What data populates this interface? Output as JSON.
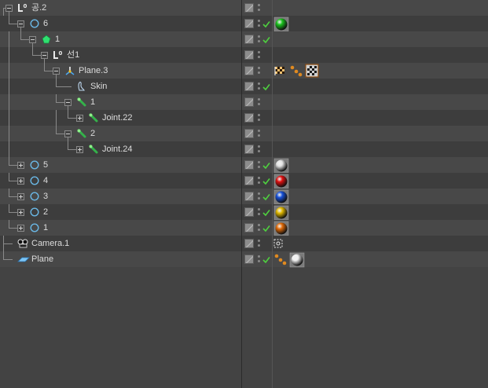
{
  "objects": [
    {
      "name": "공.2",
      "type": "null",
      "depth": 0,
      "expander": "minus",
      "check": false,
      "tags": []
    },
    {
      "name": "6",
      "type": "sphere",
      "depth": 1,
      "expander": "minus",
      "check": true,
      "tags": [
        {
          "kind": "material",
          "color": "#19c21c"
        }
      ]
    },
    {
      "name": "1",
      "type": "pentagon",
      "depth": 2,
      "expander": "minus",
      "check": true,
      "tags": []
    },
    {
      "name": "선1",
      "type": "null",
      "depth": 3,
      "expander": "minus",
      "check": false,
      "tags": []
    },
    {
      "name": "Plane.3",
      "type": "plane-deform",
      "depth": 4,
      "expander": "minus",
      "check": false,
      "tags": [
        {
          "kind": "checker-flag"
        },
        {
          "kind": "ik-dots"
        },
        {
          "kind": "checker"
        }
      ]
    },
    {
      "name": "Skin",
      "type": "skin",
      "depth": 5,
      "expander": "none",
      "check": true,
      "tags": []
    },
    {
      "name": "1",
      "type": "joint",
      "depth": 5,
      "expander": "minus",
      "check": false,
      "tags": []
    },
    {
      "name": "Joint.22",
      "type": "joint",
      "depth": 6,
      "expander": "plus",
      "check": false,
      "tags": []
    },
    {
      "name": "2",
      "type": "joint",
      "depth": 5,
      "expander": "minus",
      "check": false,
      "tags": []
    },
    {
      "name": "Joint.24",
      "type": "joint",
      "depth": 6,
      "expander": "plus",
      "check": false,
      "tags": []
    },
    {
      "name": "5",
      "type": "sphere",
      "depth": 1,
      "expander": "plus",
      "check": true,
      "tags": [
        {
          "kind": "material",
          "color": "#e2e2e2"
        }
      ]
    },
    {
      "name": "4",
      "type": "sphere",
      "depth": 1,
      "expander": "plus",
      "check": true,
      "tags": [
        {
          "kind": "material",
          "color": "#e01010"
        }
      ]
    },
    {
      "name": "3",
      "type": "sphere",
      "depth": 1,
      "expander": "plus",
      "check": true,
      "tags": [
        {
          "kind": "material",
          "color": "#1650d8"
        }
      ]
    },
    {
      "name": "2",
      "type": "sphere",
      "depth": 1,
      "expander": "plus",
      "check": true,
      "tags": [
        {
          "kind": "material",
          "color": "#e0b800"
        }
      ]
    },
    {
      "name": "1",
      "type": "sphere",
      "depth": 1,
      "expander": "plus",
      "check": true,
      "tags": [
        {
          "kind": "material",
          "color": "#e06a08"
        }
      ]
    },
    {
      "name": "Camera.1",
      "type": "camera",
      "depth": 0,
      "expander": "none",
      "check": false,
      "tags": [
        {
          "kind": "target"
        }
      ]
    },
    {
      "name": "Plane",
      "type": "plane",
      "depth": 0,
      "expander": "none",
      "check": true,
      "tags": [
        {
          "kind": "ik-dots"
        },
        {
          "kind": "material",
          "color": "#f0f0f0"
        }
      ]
    }
  ],
  "colors": {
    "line": "#8a8a8a",
    "check": "#4fcf3f",
    "joint": "#34b24a",
    "sphere_outline": "#6ab8e6",
    "null_icon": "#e8e8e8"
  }
}
